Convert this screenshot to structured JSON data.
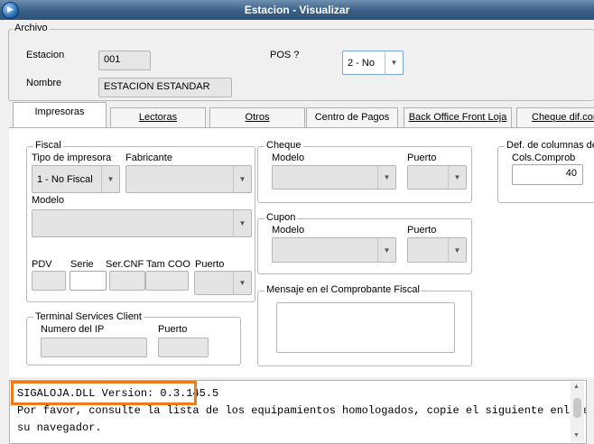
{
  "window": {
    "title": "Estacion - Visualizar"
  },
  "archivo": {
    "legend": "Archivo",
    "estacion_label": "Estacion",
    "estacion_value": "001",
    "nombre_label": "Nombre",
    "nombre_value": "ESTACION ESTANDAR",
    "pos_label": "POS ?",
    "pos_value": "2 - No"
  },
  "tabs": [
    {
      "label": "Impresoras",
      "active": true
    },
    {
      "label": "Lectoras",
      "active": false
    },
    {
      "label": "Otros",
      "active": false
    },
    {
      "label": "Centro de Pagos",
      "active": false
    },
    {
      "label": "Back Office Front Loja",
      "active": false
    },
    {
      "label": "Cheque dif.con",
      "active": false
    }
  ],
  "fiscal": {
    "legend": "Fiscal",
    "tipo_label": "Tipo de impresora",
    "tipo_value": "1 - No Fiscal",
    "fabricante_label": "Fabricante",
    "fabricante_value": "",
    "modelo_label": "Modelo",
    "modelo_value": "",
    "pdv_label": "PDV",
    "serie_label": "Serie",
    "sercnf_label": "Ser.CNF",
    "tamcoo_label": "Tam COO",
    "puerto_label": "Puerto"
  },
  "terminal": {
    "legend": "Terminal Services Client",
    "ip_label": "Numero del IP",
    "puerto_label": "Puerto"
  },
  "cheque": {
    "legend": "Cheque",
    "modelo_label": "Modelo",
    "puerto_label": "Puerto"
  },
  "cupon": {
    "legend": "Cupon",
    "modelo_label": "Modelo",
    "puerto_label": "Puerto"
  },
  "mensaje": {
    "legend": "Mensaje en el Comprobante Fiscal"
  },
  "defcol": {
    "legend": "Def. de columnas de",
    "cols_label": "Cols.Comprob",
    "cols_value": "40"
  },
  "console": {
    "lines": [
      "SIGALOJA.DLL Version: 0.3.145.5",
      "Por favor, consulte la lista de los equipamientos homologados, copie el siguiente enlace y ábralo en",
      "su navegador."
    ]
  },
  "colors": {
    "highlight": "#f07a1a",
    "titlebar": "#3a5f86"
  }
}
